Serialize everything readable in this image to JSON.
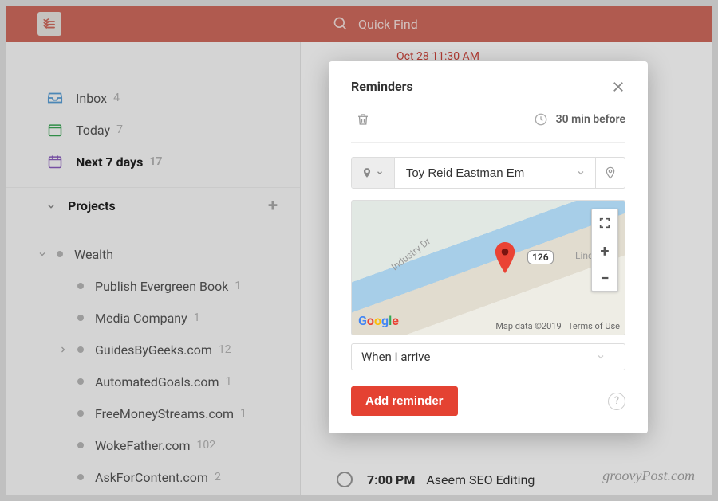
{
  "topbar": {
    "search_placeholder": "Quick Find"
  },
  "sidebar": {
    "nav": [
      {
        "label": "Inbox",
        "count": "4"
      },
      {
        "label": "Today",
        "count": "7"
      },
      {
        "label": "Next 7 days",
        "count": "17"
      }
    ],
    "section_label": "Projects",
    "wealth_label": "Wealth",
    "projects": [
      {
        "label": "Publish Evergreen Book",
        "count": "1"
      },
      {
        "label": "Media Company",
        "count": "1"
      },
      {
        "label": "GuidesByGeeks.com",
        "count": "12"
      },
      {
        "label": "AutomatedGoals.com",
        "count": "1"
      },
      {
        "label": "FreeMoneyStreams.com",
        "count": "1"
      },
      {
        "label": "WokeFather.com",
        "count": "102"
      },
      {
        "label": "AskForContent.com",
        "count": "2"
      }
    ]
  },
  "content": {
    "overdue_label": "Oct 28 11:30 AM",
    "task_time": "7:00 PM",
    "task_title": "Aseem SEO Editing"
  },
  "modal": {
    "title": "Reminders",
    "time_before": "30 min before",
    "location_value": "Toy Reid Eastman Em",
    "trigger_value": "When I arrive",
    "add_label": "Add reminder",
    "map": {
      "road1": "Industry Dr",
      "road2": "Lincol",
      "route": "126",
      "logo": "Google",
      "attribution": "Map data ©2019",
      "terms": "Terms of Use"
    }
  },
  "watermark": "groovyPost.com"
}
